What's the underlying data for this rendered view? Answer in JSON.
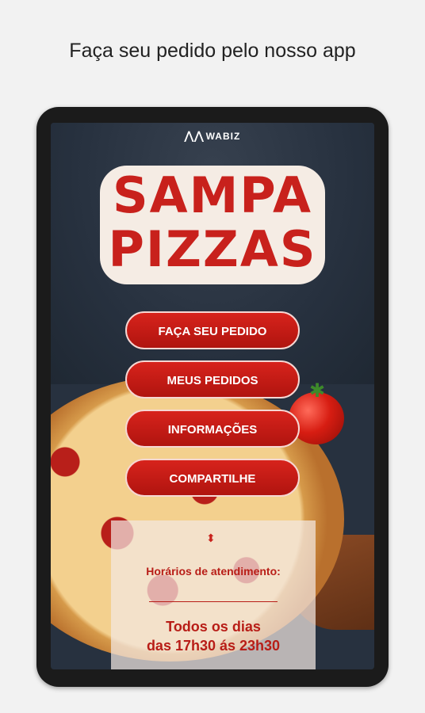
{
  "page": {
    "headline": "Faça seu pedido pelo nosso app"
  },
  "app": {
    "brand": "WABIZ",
    "logo": {
      "line1": "SAMPA",
      "line2": "PIZZAS"
    },
    "menu": [
      {
        "label": "FAÇA SEU PEDIDO"
      },
      {
        "label": "MEUS PEDIDOS"
      },
      {
        "label": "INFORMAÇÕES"
      },
      {
        "label": "COMPARTILHE"
      }
    ],
    "hours": {
      "title": "Horários de atendimento:",
      "line1": "Todos os dias",
      "line2": "das 17h30 ás 23h30"
    }
  },
  "colors": {
    "accent": "#c8211c",
    "background": "#27313f"
  },
  "icons": [
    "wabiz-logo-icon",
    "up-down-arrow-icon",
    "tomato-icon"
  ]
}
